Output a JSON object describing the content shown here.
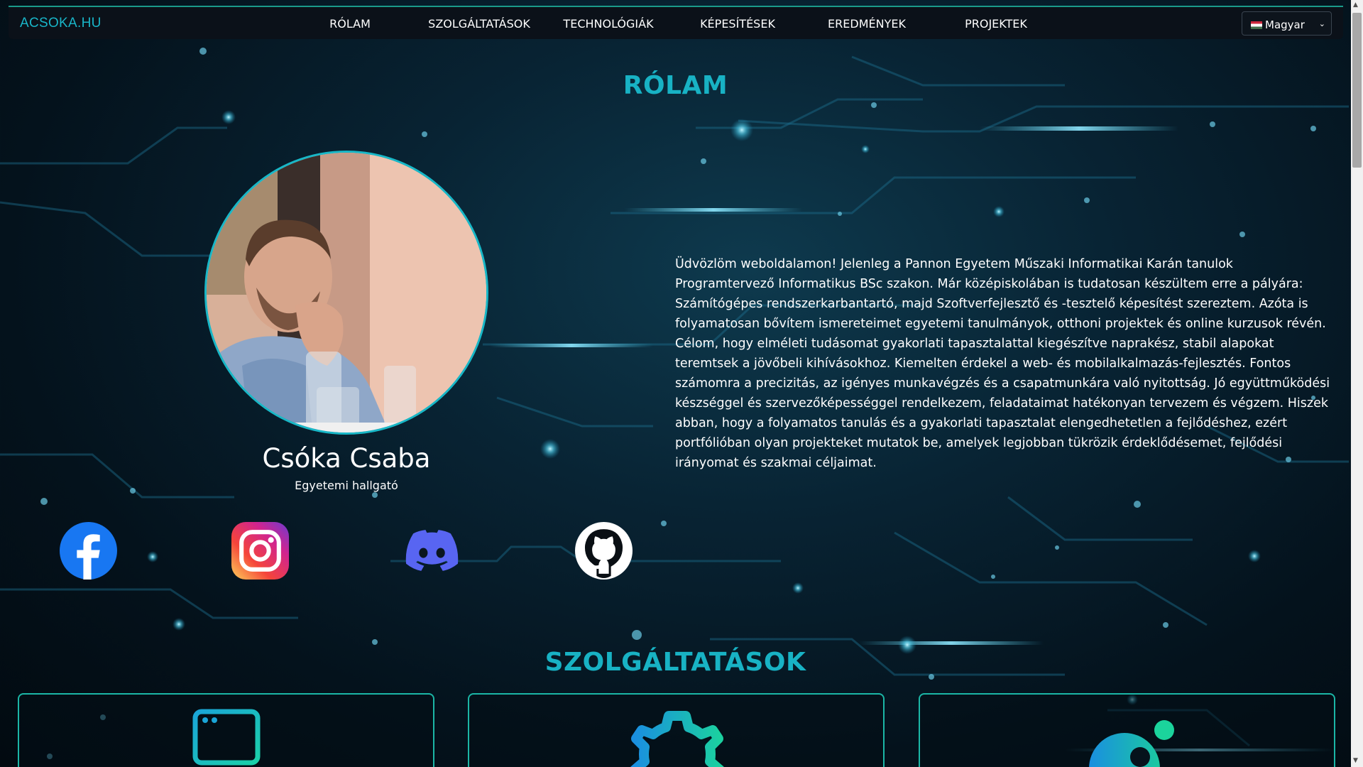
{
  "nav": {
    "logo": "ACSOKA.HU",
    "items": [
      "RÓLAM",
      "SZOLGÁLTATÁSOK",
      "TECHNOLÓGIÁK",
      "KÉPESÍTÉSEK",
      "EREDMÉNYEK",
      "PROJEKTEK"
    ],
    "language": "Magyar"
  },
  "about": {
    "heading": "RÓLAM",
    "name": "Csóka Csaba",
    "role": "Egyetemi hallgató",
    "text": "Üdvözlöm weboldalamon! Jelenleg a Pannon Egyetem Műszaki Informatikai Karán tanulok Programtervező Informatikus BSc szakon. Már középiskolában is tudatosan készültem erre a pályára: Számítógépes rendszerkarbantartó, majd Szoftverfejlesztő és -tesztelő képesítést szereztem. Azóta is folyamatosan bővítem ismereteimet egyetemi tanulmányok, otthoni projektek és online kurzusok révén. Célom, hogy elméleti tudásomat gyakorlati tapasztalattal kiegészítve naprakész, stabil alapokat teremtsek a jövőbeli kihívásokhoz. Kiemelten érdekel a web- és mobilalkalmazás-fejlesztés. Fontos számomra a precizitás, az igényes munkavégzés és a csapatmunkára való nyitottság. Jó együttműködési készséggel és szervezőképességgel rendelkezem, feladataimat hatékonyan tervezem és végzem. Hiszek abban, hogy a folyamatos tanulás és a gyakorlati tapasztalat elengedhetetlen a fejlődéshez, ezért portfólióban olyan projekteket mutatok be, amelyek legjobban tükrözik érdeklődésemet, fejlődési irányomat és szakmai céljaimat."
  },
  "social": {
    "icons": [
      "facebook-icon",
      "instagram-icon",
      "discord-icon",
      "github-icon"
    ]
  },
  "services": {
    "heading": "SZOLGÁLTATÁSOK",
    "card_icons": [
      "browser-window-icon",
      "gear-icon",
      "design-icon"
    ]
  },
  "colors": {
    "accent": "#18b2c4",
    "nav_bg": "#0b1119",
    "card_border": "#1bb6a6"
  }
}
